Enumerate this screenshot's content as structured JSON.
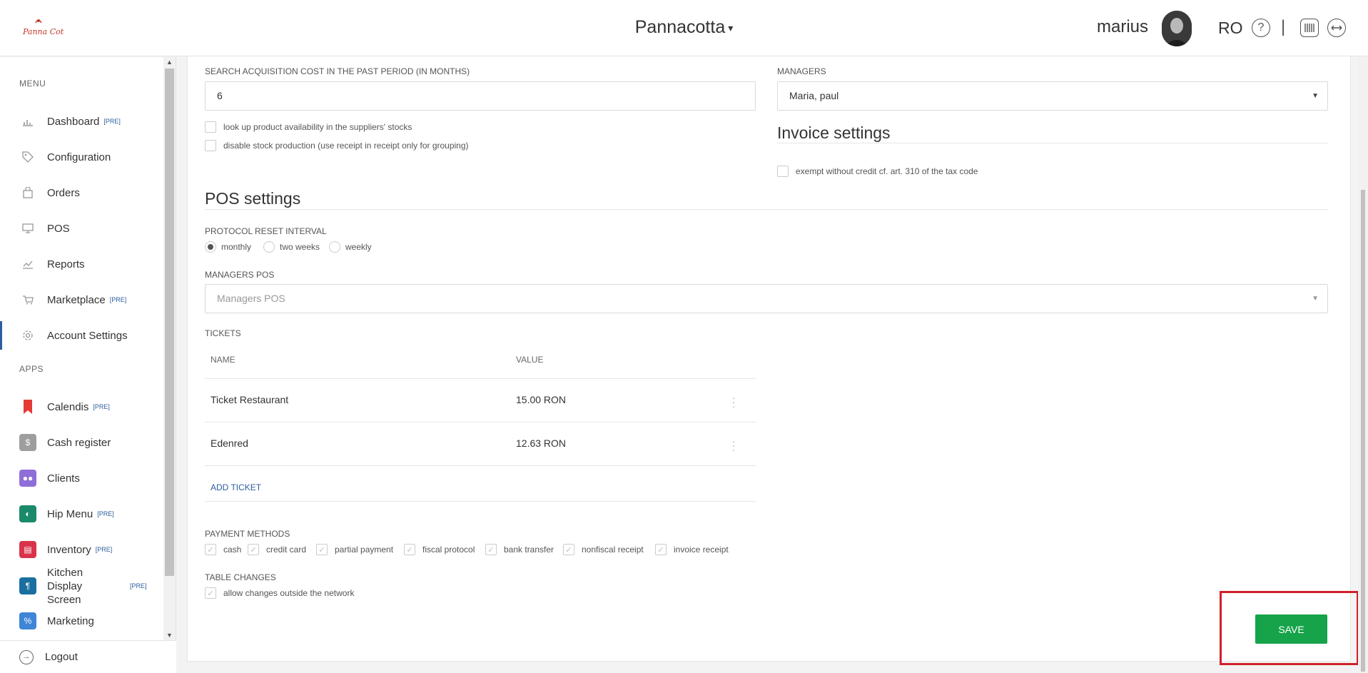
{
  "header": {
    "company": "Pannacotta",
    "user": "marius",
    "lang": "RO",
    "help_icon": "question-circle-icon",
    "apps_icon": "barcode-icon",
    "toggle_icon": "arrows-horizontal-icon"
  },
  "sidebar": {
    "menu_title": "MENU",
    "apps_title": "APPS",
    "pre_tag": "[PRE]",
    "items": [
      {
        "label": "Dashboard",
        "pre": true,
        "icon": "bar-chart-icon"
      },
      {
        "label": "Configuration",
        "pre": false,
        "icon": "tag-icon"
      },
      {
        "label": "Orders",
        "pre": false,
        "icon": "shopping-bag-icon"
      },
      {
        "label": "POS",
        "pre": false,
        "icon": "monitor-icon"
      },
      {
        "label": "Reports",
        "pre": false,
        "icon": "line-chart-icon"
      },
      {
        "label": "Marketplace",
        "pre": true,
        "icon": "cart-icon"
      },
      {
        "label": "Account Settings",
        "pre": false,
        "icon": "gear-icon",
        "active": true
      }
    ],
    "apps": [
      {
        "label": "Calendis",
        "pre": true,
        "color": "#e53935"
      },
      {
        "label": "Cash register",
        "pre": false,
        "color": "#9e9e9e"
      },
      {
        "label": "Clients",
        "pre": false,
        "color": "#8e6fd8"
      },
      {
        "label": "Hip Menu",
        "pre": true,
        "color": "#1b8a6b"
      },
      {
        "label": "Inventory",
        "pre": true,
        "color": "#d9344a"
      },
      {
        "label": "Kitchen Display Screen",
        "pre": true,
        "color": "#1a6fa0"
      },
      {
        "label": "Marketing",
        "pre": false,
        "color": "#3f86d6"
      }
    ],
    "logout": "Logout"
  },
  "acquisition": {
    "label": "SEARCH ACQUISITION COST IN THE PAST PERIOD (IN MONTHS)",
    "value": "6"
  },
  "options": [
    "look up product availability in the suppliers' stocks",
    "disable stock production (use receipt in receipt only for grouping)"
  ],
  "managers": {
    "label": "MANAGERS",
    "value": "Maria, paul"
  },
  "invoice": {
    "title": "Invoice settings",
    "option": "exempt without credit cf. art. 310 of the tax code"
  },
  "pos": {
    "title": "POS settings",
    "protocol_label": "PROTOCOL RESET INTERVAL",
    "protocol_options": [
      "monthly",
      "two weeks",
      "weekly"
    ],
    "protocol_selected": "monthly",
    "managers_pos_label": "MANAGERS POS",
    "managers_pos_placeholder": "Managers POS"
  },
  "tickets": {
    "label": "TICKETS",
    "columns": [
      "NAME",
      "VALUE"
    ],
    "rows": [
      {
        "name": "Ticket Restaurant",
        "value": "15.00 RON"
      },
      {
        "name": "Edenred",
        "value": "12.63 RON"
      }
    ],
    "add": "ADD TICKET"
  },
  "payment": {
    "label": "PAYMENT METHODS",
    "methods": [
      "cash",
      "credit card",
      "partial payment",
      "fiscal protocol",
      "bank transfer",
      "nonfiscal receipt",
      "invoice receipt"
    ]
  },
  "table_changes": {
    "label": "TABLE CHANGES",
    "option": "allow changes outside the network"
  },
  "save": "SAVE"
}
